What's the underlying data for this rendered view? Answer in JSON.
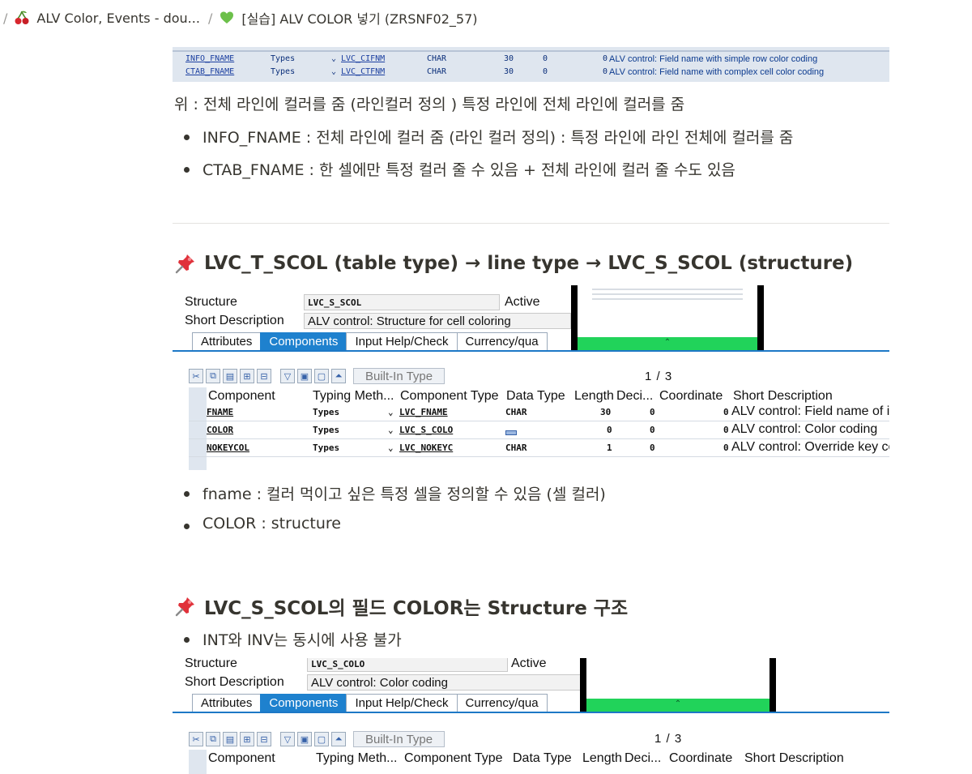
{
  "breadcrumb": {
    "items": [
      {
        "label": "ALV Color, Events - dou...",
        "icon": "cherry-icon"
      },
      {
        "label": "[실습] ALV COLOR 넣기 (ZRSNF02_57)",
        "icon": "green-heart-icon"
      }
    ],
    "separator": "/"
  },
  "top_table": {
    "rows": [
      {
        "name": "INFO_FNAME",
        "typing": "Types",
        "type": "LVC_CIFNM",
        "dtype": "CHAR",
        "len": "30",
        "dec": "0",
        "coord": "0",
        "desc": "ALV control: Field name with simple row color coding"
      },
      {
        "name": "CTAB_FNAME",
        "typing": "Types",
        "type": "LVC_CTFNM",
        "dtype": "CHAR",
        "len": "30",
        "dec": "0",
        "coord": "0",
        "desc": "ALV control: Field name with complex cell color coding"
      }
    ]
  },
  "intro": {
    "text": "위 : 전체 라인에 컬러를 줌 (라인컬러 정의 ) 특정 라인에 전체 라인에 컬러를 줌",
    "bullets": [
      "INFO_FNAME : 전체 라인에 컬러 줌 (라인 컬러 정의) : 특정 라인에 라인 전체에 컬러를 줌",
      "CTAB_FNAME : 한 셀에만 특정 컬러 줄 수 있음 + 전체 라인에 컬러 줄 수도 있음"
    ]
  },
  "section1": {
    "heading": "LVC_T_SCOL (table type) → line type → LVC_S_SCOL (structure)",
    "sap": {
      "structure_label": "Structure",
      "structure_value": "LVC_S_SCOL",
      "status": "Active",
      "short_desc_label": "Short Description",
      "short_desc_value": "ALV control: Structure for cell coloring",
      "tabs": [
        "Attributes",
        "Components",
        "Input Help/Check",
        "Currency/qua"
      ],
      "builtin_label": "Built-In Type",
      "pager": "1 / 3",
      "columns": [
        "Component",
        "Typing Meth...",
        "Component Type",
        "Data Type",
        "Length",
        "Deci...",
        "Coordinate",
        "Short Description"
      ],
      "rows": [
        {
          "name": "FNAME",
          "typing": "Types",
          "type": "LVC_FNAME",
          "dtype": "CHAR",
          "len": "30",
          "dec": "0",
          "coord": "0",
          "desc": "ALV control: Field name of i"
        },
        {
          "name": "COLOR",
          "typing": "Types",
          "type": "LVC_S_COLO",
          "dtype": "",
          "len": "0",
          "dec": "0",
          "coord": "0",
          "desc": "ALV control: Color coding"
        },
        {
          "name": "NOKEYCOL",
          "typing": "Types",
          "type": "LVC_NOKEYC",
          "dtype": "CHAR",
          "len": "1",
          "dec": "0",
          "coord": "0",
          "desc": "ALV control: Override key co"
        }
      ]
    },
    "bullets": [
      "fname : 컬러 먹이고 싶은 특정 셀을 정의할 수 있음 (셀 컬러)",
      "COLOR  : structure"
    ]
  },
  "section2": {
    "heading": "LVC_S_SCOL의 필드 COLOR는 Structure 구조",
    "bullets": [
      "INT와 INV는 동시에 사용 불가"
    ],
    "sap": {
      "structure_label": "Structure",
      "structure_value": "LVC_S_COLO",
      "status": "Active",
      "short_desc_label": "Short Description",
      "short_desc_value": "ALV control: Color coding",
      "tabs": [
        "Attributes",
        "Components",
        "Input Help/Check",
        "Currency/qua"
      ],
      "builtin_label": "Built-In Type",
      "pager": "1 / 3",
      "columns": [
        "Component",
        "Typing Meth...",
        "Component Type",
        "Data Type",
        "Length",
        "Deci...",
        "Coordinate",
        "Short Description"
      ]
    }
  },
  "colors": {
    "sap_tab_active": "#1e81ce",
    "overlay_green": "#21d35a",
    "text": "#37352f"
  }
}
